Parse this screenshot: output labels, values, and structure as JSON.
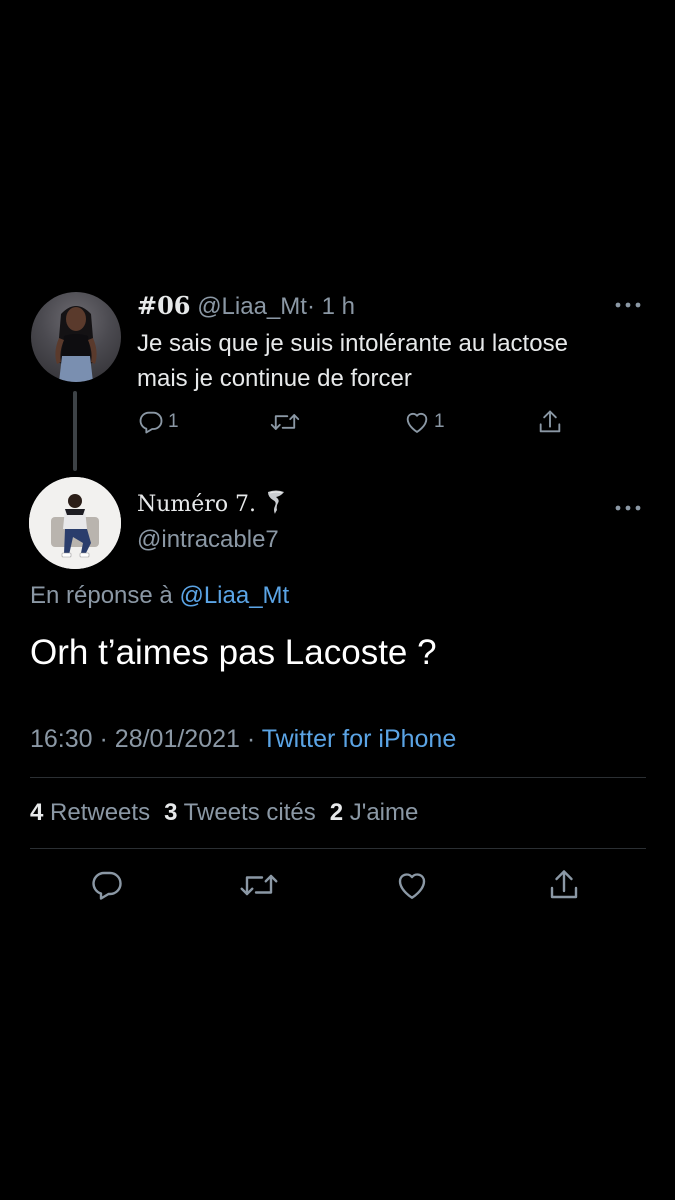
{
  "parent_tweet": {
    "display_name": "#06",
    "handle": "@Liaa_Mt",
    "separator": "·",
    "time_ago": "1 h",
    "text_line1": "Je sais que je suis intolérante au lactose",
    "text_line2": "mais je continue de forcer",
    "reply_count": "1",
    "like_count": "1"
  },
  "main_tweet": {
    "display_name": "Numéro 7.",
    "handle": "@intracable7",
    "reply_prefix": "En réponse à",
    "reply_handle": "@Liaa_Mt",
    "text": "Orh t’aimes pas Lacoste ?",
    "time": "16:30",
    "date": "28/01/2021",
    "meta_separator": "·",
    "source": "Twitter for iPhone",
    "retweets_count": "4",
    "retweets_label": "Retweets",
    "quotes_count": "3",
    "quotes_label": "Tweets cités",
    "likes_count": "2",
    "likes_label": "J'aime"
  },
  "colors": {
    "background": "#000000",
    "text_primary": "#e7e9ea",
    "text_secondary": "#8b98a5",
    "link": "#5ba4e5",
    "divider": "#2b2f33"
  },
  "icons": {
    "more": "more-horizontal-icon",
    "reply": "reply-bubble-icon",
    "retweet": "retweet-icon",
    "like": "heart-icon",
    "share": "share-icon",
    "name_emoji": "tornado-emoji-icon"
  }
}
